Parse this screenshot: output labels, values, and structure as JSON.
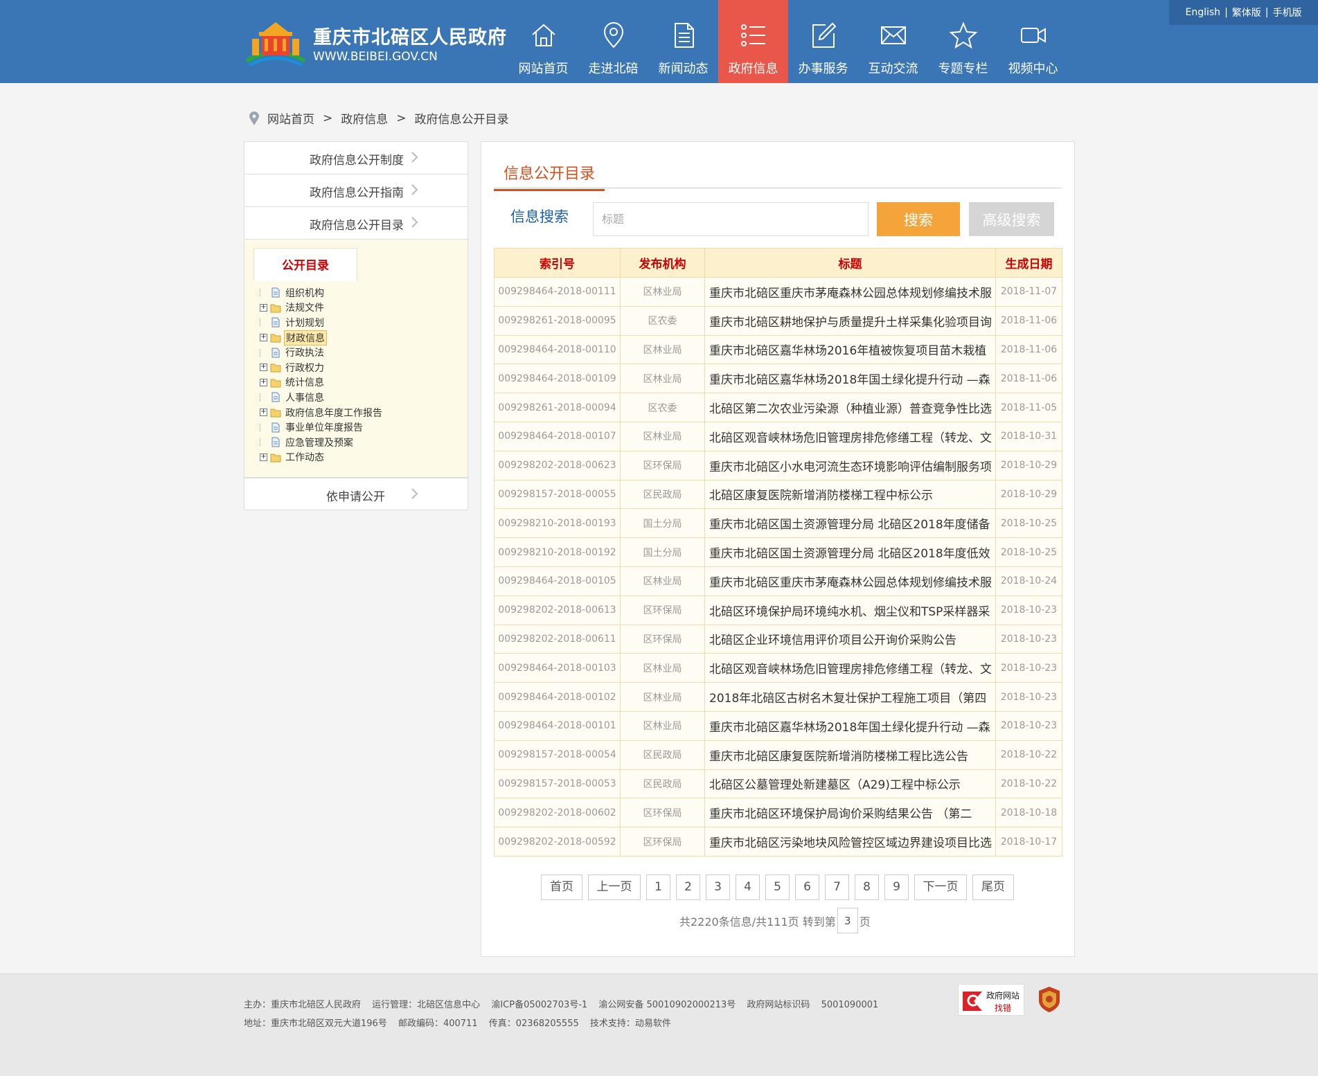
{
  "header": {
    "site_title": "重庆市北碚区人民政府",
    "site_url": "WWW.BEIBEI.GOV.CN",
    "lang_links": [
      "English",
      "繁体版",
      "手机版"
    ],
    "nav": [
      {
        "label": "网站首页",
        "icon": "home-icon"
      },
      {
        "label": "走进北碚",
        "icon": "location-pin-icon"
      },
      {
        "label": "新闻动态",
        "icon": "document-icon"
      },
      {
        "label": "政府信息",
        "icon": "list-icon",
        "active": true
      },
      {
        "label": "办事服务",
        "icon": "edit-icon"
      },
      {
        "label": "互动交流",
        "icon": "mail-icon"
      },
      {
        "label": "专题专栏",
        "icon": "star-icon"
      },
      {
        "label": "视频中心",
        "icon": "video-camera-icon"
      }
    ]
  },
  "breadcrumb": [
    "网站首页",
    "政府信息",
    "政府信息公开目录"
  ],
  "breadcrumb_sep": ">",
  "sidebar": {
    "links": [
      "政府信息公开制度",
      "政府信息公开指南",
      "政府信息公开目录"
    ],
    "tree_tab": "公开目录",
    "tree": [
      {
        "label": "组织机构",
        "expandable": false,
        "icon": "page"
      },
      {
        "label": "法规文件",
        "expandable": true,
        "icon": "folder"
      },
      {
        "label": "计划规划",
        "expandable": false,
        "icon": "page"
      },
      {
        "label": "财政信息",
        "expandable": true,
        "icon": "folder",
        "selected": true
      },
      {
        "label": "行政执法",
        "expandable": false,
        "icon": "page"
      },
      {
        "label": "行政权力",
        "expandable": true,
        "icon": "folder"
      },
      {
        "label": "统计信息",
        "expandable": true,
        "icon": "folder"
      },
      {
        "label": "人事信息",
        "expandable": false,
        "icon": "page"
      },
      {
        "label": "政府信息年度工作报告",
        "expandable": true,
        "icon": "folder"
      },
      {
        "label": "事业单位年度报告",
        "expandable": false,
        "icon": "page"
      },
      {
        "label": "应急管理及预案",
        "expandable": false,
        "icon": "page"
      },
      {
        "label": "工作动态",
        "expandable": true,
        "icon": "folder"
      }
    ],
    "apply_link": "依申请公开"
  },
  "main": {
    "title": "信息公开目录",
    "search": {
      "label": "信息搜索",
      "placeholder": "标题",
      "value": "",
      "search_button": "搜索",
      "advanced_button": "高级搜索"
    },
    "table": {
      "headers": [
        "索引号",
        "发布机构",
        "标题",
        "生成日期"
      ],
      "rows": [
        [
          "009298464-2018-00111",
          "区林业局",
          "重庆市北碚区重庆市茅庵森林公园总体规划修编技术服",
          "2018-11-07"
        ],
        [
          "009298261-2018-00095",
          "区农委",
          "重庆市北碚区耕地保护与质量提升土样采集化验项目询",
          "2018-11-06"
        ],
        [
          "009298464-2018-00110",
          "区林业局",
          "重庆市北碚区嘉华林场2016年植被恢复项目苗木栽植",
          "2018-11-06"
        ],
        [
          "009298464-2018-00109",
          "区林业局",
          "重庆市北碚区嘉华林场2018年国土绿化提升行动 —森",
          "2018-11-06"
        ],
        [
          "009298261-2018-00094",
          "区农委",
          "北碚区第二次农业污染源（种植业源）普查竞争性比选",
          "2018-11-05"
        ],
        [
          "009298464-2018-00107",
          "区林业局",
          "北碚区观音峡林场危旧管理房排危修缮工程（转龙、文",
          "2018-10-31"
        ],
        [
          "009298202-2018-00623",
          "区环保局",
          "重庆市北碚区小水电河流生态环境影响评估编制服务项",
          "2018-10-29"
        ],
        [
          "009298157-2018-00055",
          "区民政局",
          "北碚区康复医院新增消防楼梯工程中标公示",
          "2018-10-29"
        ],
        [
          "009298210-2018-00193",
          "国土分局",
          "重庆市北碚区国土资源管理分局 北碚区2018年度储备",
          "2018-10-25"
        ],
        [
          "009298210-2018-00192",
          "国土分局",
          "重庆市北碚区国土资源管理分局 北碚区2018年度低效",
          "2018-10-25"
        ],
        [
          "009298464-2018-00105",
          "区林业局",
          "重庆市北碚区重庆市茅庵森林公园总体规划修编技术服",
          "2018-10-24"
        ],
        [
          "009298202-2018-00613",
          "区环保局",
          "北碚区环境保护局环境纯水机、烟尘仪和TSP采样器采",
          "2018-10-23"
        ],
        [
          "009298202-2018-00611",
          "区环保局",
          "北碚区企业环境信用评价项目公开询价采购公告",
          "2018-10-23"
        ],
        [
          "009298464-2018-00103",
          "区林业局",
          "北碚区观音峡林场危旧管理房排危修缮工程（转龙、文",
          "2018-10-23"
        ],
        [
          "009298464-2018-00102",
          "区林业局",
          "2018年北碚区古树名木复壮保护工程施工项目（第四",
          "2018-10-23"
        ],
        [
          "009298464-2018-00101",
          "区林业局",
          "重庆市北碚区嘉华林场2018年国土绿化提升行动 —森",
          "2018-10-23"
        ],
        [
          "009298157-2018-00054",
          "区民政局",
          "重庆市北碚区康复医院新增消防楼梯工程比选公告",
          "2018-10-22"
        ],
        [
          "009298157-2018-00053",
          "区民政局",
          "北碚区公墓管理处新建墓区（A29)工程中标公示",
          "2018-10-22"
        ],
        [
          "009298202-2018-00602",
          "区环保局",
          "重庆市北碚区环境保护局询价采购结果公告 （第二",
          "2018-10-18"
        ],
        [
          "009298202-2018-00592",
          "区环保局",
          "重庆市北碚区污染地块风险管控区域边界建设项目比选",
          "2018-10-17"
        ]
      ]
    },
    "pager": {
      "first": "首页",
      "prev": "上一页",
      "pages": [
        "1",
        "2",
        "3",
        "4",
        "5",
        "6",
        "7",
        "8",
        "9"
      ],
      "next": "下一页",
      "last": "尾页",
      "info_prefix": "共2220条信息/共111页 转到第",
      "goto_value": "3",
      "info_suffix": "页"
    }
  },
  "footer": {
    "line1": [
      "主办：重庆市北碚区人民政府",
      "运行管理：北碚区信息中心",
      "渝ICP备05002703号-1",
      "渝公网安备 50010902000213号",
      "政府网站标识码",
      "5001090001"
    ],
    "line2": [
      "地址：重庆市北碚区双元大道196号",
      "邮政编码：400711",
      "传真：02368205555",
      "技术支持：动易软件"
    ],
    "badge_text_1": "政府网站",
    "badge_text_2": "找错"
  },
  "colors": {
    "header_bg": "#3a76b5",
    "nav_active": "#e8574a",
    "accent_orange": "#d2501c",
    "search_button": "#f5a43a",
    "table_header_text": "#cc0000"
  }
}
